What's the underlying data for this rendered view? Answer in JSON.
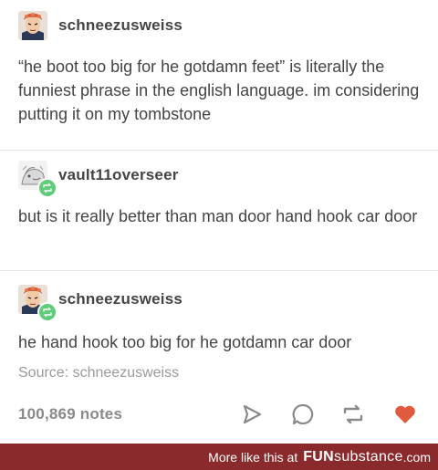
{
  "posts": [
    {
      "username": "schneezusweiss",
      "text": "“he boot too big for he gotdamn feet” is literally the funniest phrase in the english language. im considering putting it on my tombstone",
      "avatar": "anime-character-avatar"
    },
    {
      "username": "vault11overseer",
      "text": "but is it really better than man door hand hook car door",
      "avatar": "gray-sketch-avatar",
      "reblog_badge": "reblog-icon"
    },
    {
      "username": "schneezusweiss",
      "text": "he hand hook too big for he gotdamn car door",
      "avatar": "anime-character-avatar",
      "reblog_badge": "reblog-icon"
    }
  ],
  "source": {
    "label": "Source:",
    "name": "schneezusweiss"
  },
  "footer": {
    "notes": "100,869 notes",
    "actions": [
      "share-icon",
      "reply-icon",
      "reblog-icon",
      "like-heart-icon"
    ],
    "like_color": "#e05a3e",
    "icon_color": "#8a8a8a"
  },
  "banner": {
    "more_text": "More like this at",
    "brand_bold": "FUN",
    "brand_light": "substance",
    "brand_suffix": ".com",
    "background": "#8a2a2d"
  }
}
